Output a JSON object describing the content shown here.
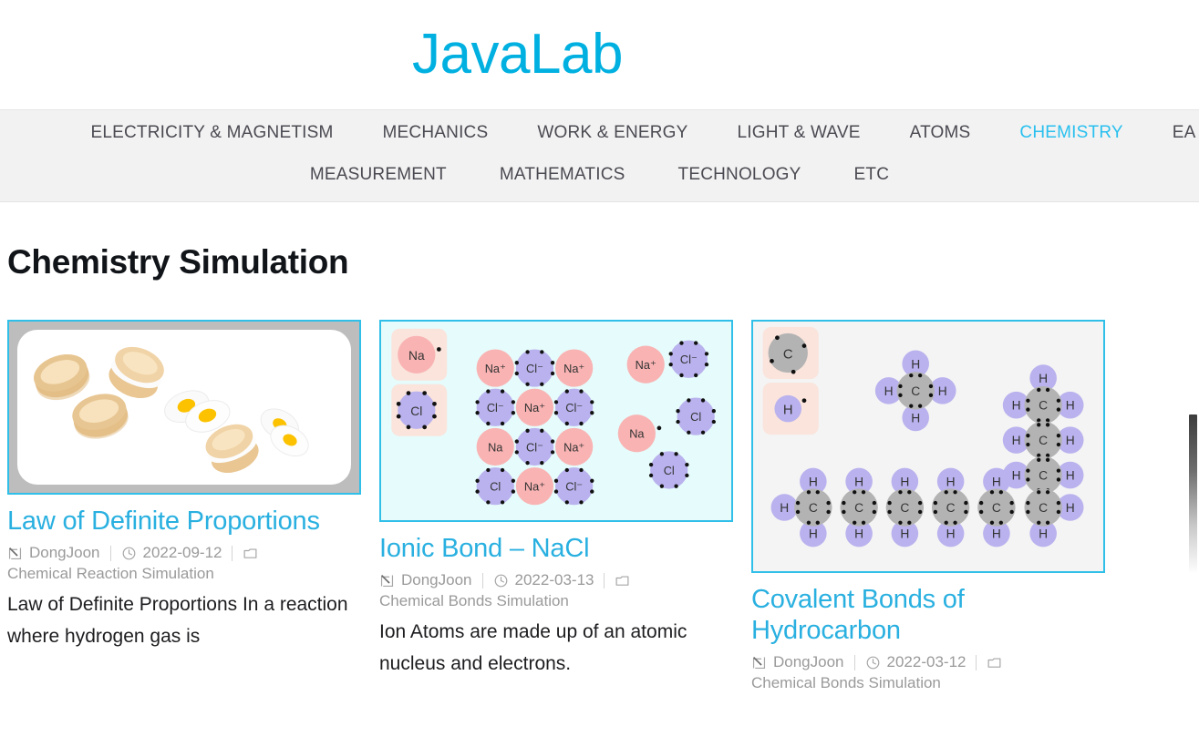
{
  "site": {
    "logo": "JavaLab"
  },
  "nav": {
    "row1": [
      {
        "label": "ELECTRICITY & MAGNETISM",
        "active": false
      },
      {
        "label": "MECHANICS",
        "active": false
      },
      {
        "label": "WORK & ENERGY",
        "active": false
      },
      {
        "label": "LIGHT & WAVE",
        "active": false
      },
      {
        "label": "ATOMS",
        "active": false
      },
      {
        "label": "CHEMISTRY",
        "active": true
      },
      {
        "label": "EA",
        "active": false
      }
    ],
    "row2": [
      {
        "label": "MEASUREMENT"
      },
      {
        "label": "MATHEMATICS"
      },
      {
        "label": "TECHNOLOGY"
      },
      {
        "label": "ETC"
      }
    ]
  },
  "page": {
    "title": "Chemistry Simulation"
  },
  "cards": [
    {
      "title": "Law of Definite Proportions",
      "author": "DongJoon",
      "date": "2022-09-12",
      "category": "Chemical Reaction Simulation",
      "excerpt": "Law of Definite Proportions In a reaction where hydrogen gas is",
      "thumb": "bread-and-egg-illustration"
    },
    {
      "title": "Ionic Bond – NaCl",
      "author": "DongJoon",
      "date": "2022-03-13",
      "category": "Chemical Bonds Simulation",
      "excerpt": "Ion Atoms are made up of an atomic nucleus and electrons.",
      "thumb": "nacl-ionic-lattice-illustration",
      "legend": [
        "Na",
        "Cl"
      ],
      "lattice": [
        [
          "Na⁺",
          "Cl⁻",
          "Na⁺"
        ],
        [
          "Cl⁻",
          "Na⁺",
          "Cl⁻"
        ],
        [
          "Na",
          "Cl⁻",
          "Na⁺"
        ],
        [
          "Cl",
          "Na⁺",
          "Cl⁻"
        ]
      ],
      "free_ions": [
        "Na⁺",
        "Cl⁻",
        "Cl",
        "Na",
        "Cl"
      ]
    },
    {
      "title": "Covalent Bonds of Hydrocarbon",
      "author": "DongJoon",
      "date": "2022-03-12",
      "category": "Chemical Bonds Simulation",
      "excerpt": "",
      "thumb": "hydrocarbon-covalent-illustration",
      "legend": [
        "C",
        "H"
      ],
      "atoms": [
        "C",
        "H"
      ]
    }
  ],
  "icons": {
    "author": "pencil-icon",
    "date": "clock-icon",
    "category": "folder-icon"
  },
  "colors": {
    "accent": "#29b0e0",
    "logo": "#00b0e0",
    "nav_text": "#4a4a52",
    "nav_active": "#29c0ef",
    "nav_bg": "#f2f2f2",
    "meta_text": "#9a9a9a"
  }
}
